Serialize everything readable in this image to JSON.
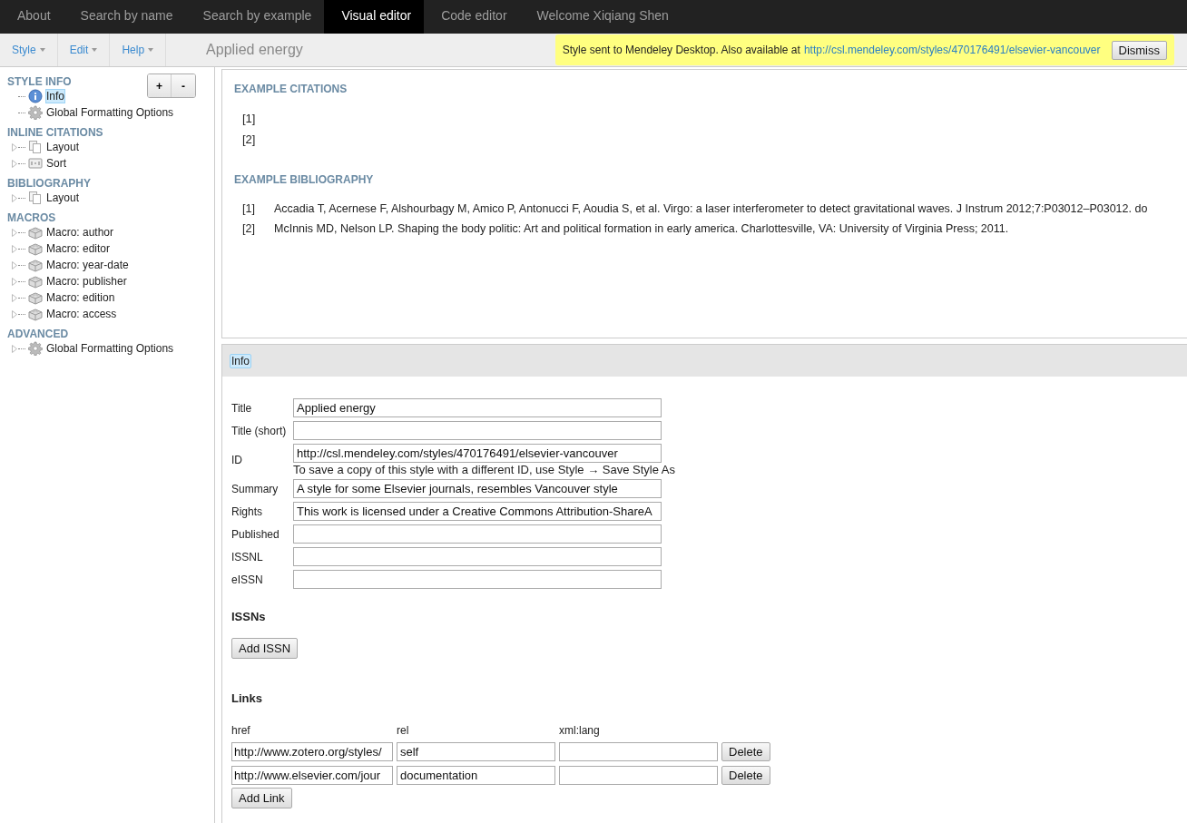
{
  "nav": {
    "tabs": [
      {
        "label": "About",
        "selected": false
      },
      {
        "label": "Search by name",
        "selected": false
      },
      {
        "label": "Search by example",
        "selected": false
      },
      {
        "label": "Visual editor",
        "selected": true
      },
      {
        "label": "Code editor",
        "selected": false
      },
      {
        "label": "Welcome Xiqiang Shen",
        "selected": false
      }
    ]
  },
  "menubar": {
    "menus": [
      "Style",
      "Edit",
      "Help"
    ],
    "style_title": "Applied energy"
  },
  "notification": {
    "text": "Style sent to Mendeley Desktop. Also available at",
    "link": "http://csl.mendeley.com/styles/470176491/elsevier-vancouver",
    "button": "Dismiss"
  },
  "sidebar": {
    "buttons": [
      "+",
      "-"
    ],
    "sections": [
      {
        "heading": "STYLE INFO",
        "items": [
          {
            "label": "Info",
            "kind": "info",
            "expandable": false,
            "selected": true
          },
          {
            "label": "Global Formatting Options",
            "kind": "gear",
            "expandable": false,
            "selected": false
          }
        ]
      },
      {
        "heading": "INLINE CITATIONS",
        "items": [
          {
            "label": "Layout",
            "kind": "pages",
            "expandable": true,
            "selected": false
          },
          {
            "label": "Sort",
            "kind": "sort",
            "expandable": true,
            "selected": false
          }
        ]
      },
      {
        "heading": "BIBLIOGRAPHY",
        "items": [
          {
            "label": "Layout",
            "kind": "pages",
            "expandable": true,
            "selected": false
          }
        ]
      },
      {
        "heading": "MACROS",
        "items": [
          {
            "label": "Macro: author",
            "kind": "brick",
            "expandable": true,
            "selected": false
          },
          {
            "label": "Macro: editor",
            "kind": "brick",
            "expandable": true,
            "selected": false
          },
          {
            "label": "Macro: year-date",
            "kind": "brick",
            "expandable": true,
            "selected": false
          },
          {
            "label": "Macro: publisher",
            "kind": "brick",
            "expandable": true,
            "selected": false
          },
          {
            "label": "Macro: edition",
            "kind": "brick",
            "expandable": true,
            "selected": false
          },
          {
            "label": "Macro: access",
            "kind": "brick",
            "expandable": true,
            "selected": false
          }
        ]
      },
      {
        "heading": "ADVANCED",
        "items": [
          {
            "label": "Global Formatting Options",
            "kind": "gear",
            "expandable": true,
            "selected": false
          }
        ]
      }
    ]
  },
  "preview": {
    "citations_heading": "EXAMPLE CITATIONS",
    "citations": [
      "[1]",
      "[2]"
    ],
    "bibliography_heading": "EXAMPLE BIBLIOGRAPHY",
    "bibliography": [
      {
        "number": "[1]",
        "text": "Accadia T, Acernese F, Alshourbagy M, Amico P, Antonucci F, Aoudia S, et al. Virgo: a laser interferometer to detect gravitational waves. J Instrum 2012;7:P03012–P03012. do"
      },
      {
        "number": "[2]",
        "text": "McInnis MD, Nelson LP. Shaping the body politic: Art and political formation in early america. Charlottesville, VA: University of Virginia Press; 2011."
      }
    ]
  },
  "editor": {
    "header": "Info",
    "fields": [
      {
        "label": "Title",
        "value": "Applied energy"
      },
      {
        "label": "Title (short)"
      },
      {
        "label": "ID",
        "value": "http://csl.mendeley.com/styles/470176491/elsevier-vancouver",
        "note": "To save a copy of this style with a different ID, use Style → Save Style As"
      },
      {
        "label": "Summary",
        "value": "A style for some Elsevier journals, resembles Vancouver style"
      },
      {
        "label": "Rights",
        "value": "This work is licensed under a Creative Commons Attribution-ShareA"
      },
      {
        "label": "Published"
      },
      {
        "label": "ISSNL"
      },
      {
        "label": "eISSN"
      }
    ],
    "issns_heading": "ISSNs",
    "add_issn": "Add ISSN",
    "links_heading": "Links",
    "link_columns": [
      "href",
      "rel",
      "xml:lang"
    ],
    "links": [
      {
        "href": "http://www.zotero.org/styles/",
        "rel": "self",
        "delete": "Delete"
      },
      {
        "href": "http://www.elsevier.com/jour",
        "rel": "documentation",
        "delete": "Delete"
      }
    ],
    "add_link": "Add Link"
  }
}
